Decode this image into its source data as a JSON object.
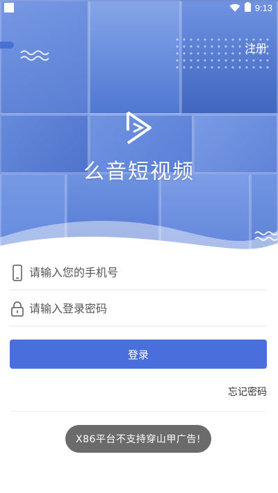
{
  "status_bar": {
    "time": "9:13"
  },
  "header": {
    "register_label": "注册"
  },
  "logo": {
    "app_name": "么音短视频"
  },
  "form": {
    "phone_placeholder": "请输入您的手机号",
    "password_placeholder": "请输入登录密码",
    "login_label": "登录",
    "forgot_label": "忘记密码"
  },
  "toast": {
    "message": "X86平台不支持穿山甲广告!"
  },
  "colors": {
    "accent": "#4a6fdc",
    "hero_blue": "#5b86dd",
    "toast_bg": "#6b6b6b"
  },
  "icons": [
    "wifi-icon",
    "battery-icon",
    "play-logo-icon",
    "phone-icon",
    "lock-icon",
    "wave-icon"
  ]
}
